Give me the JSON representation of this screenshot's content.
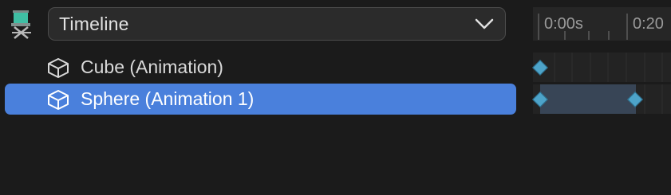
{
  "header": {
    "icon": "film-director-chair-icon",
    "dropdown": {
      "selected": "Timeline",
      "icon": "chevron-down-icon"
    }
  },
  "tree": {
    "items": [
      {
        "label": "Cube (Animation)",
        "icon": "cube-icon",
        "selected": false
      },
      {
        "label": "Sphere (Animation 1)",
        "icon": "cube-icon",
        "selected": true
      }
    ]
  },
  "timeline": {
    "ruler": {
      "labels": [
        "0:00s",
        "0:20"
      ]
    }
  },
  "colors": {
    "background": "#1b1b1b",
    "selection": "#4a80dc",
    "keyframe": "#4da3c9",
    "clip": "#384556"
  }
}
